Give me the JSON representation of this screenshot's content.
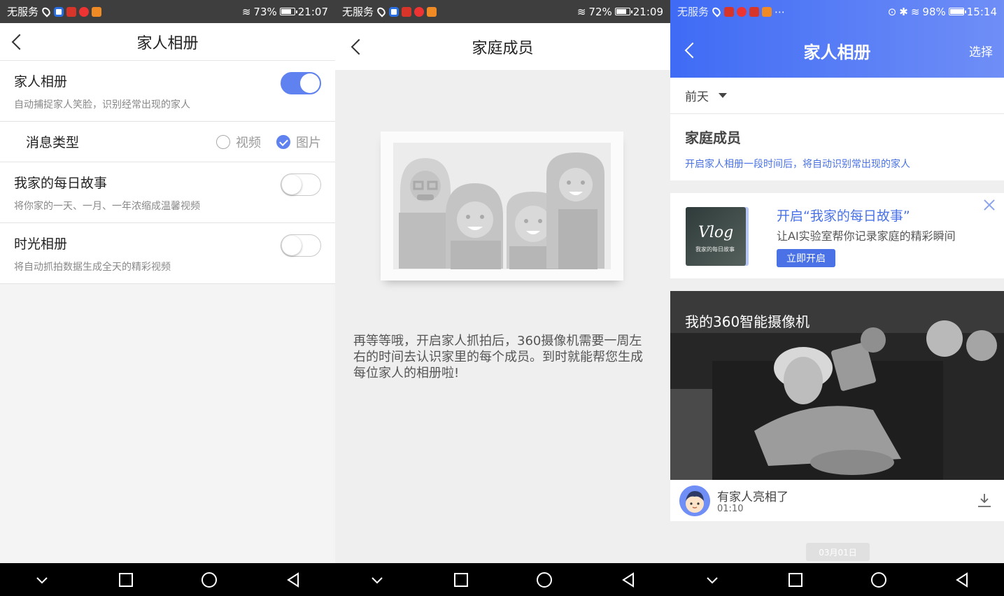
{
  "panel1": {
    "status": {
      "carrier": "无服务",
      "battery": "73%",
      "battery_fill": 0.73,
      "time": "21:07"
    },
    "title": "家人相册",
    "rows": [
      {
        "title": "家人相册",
        "desc": "自动捕捉家人笑脸，识别经常出现的家人",
        "toggle_on": true
      },
      {
        "title": "我家的每日故事",
        "desc": "将你家的一天、一月、一年浓缩成温馨视频",
        "toggle_on": false
      },
      {
        "title": "时光相册",
        "desc": "将自动抓拍数据生成全天的精彩视频",
        "toggle_on": false
      }
    ],
    "msg_type": {
      "label": "消息类型",
      "options": [
        {
          "label": "视频",
          "checked": false
        },
        {
          "label": "图片",
          "checked": true
        }
      ]
    }
  },
  "panel2": {
    "status": {
      "carrier": "无服务",
      "battery": "72%",
      "battery_fill": 0.72,
      "time": "21:09"
    },
    "title": "家庭成员",
    "message": "再等等哦，开启家人抓拍后，360摄像机需要一周左右的时间去认识家里的每个成员。到时就能帮您生成每位家人的相册啦!"
  },
  "panel3": {
    "status": {
      "carrier": "无服务",
      "battery": "98%",
      "battery_fill": 0.98,
      "time": "15:14"
    },
    "title": "家人相册",
    "select": "选择",
    "date_filter": "前天",
    "family": {
      "title": "家庭成员",
      "desc": "开启家人相册一段时间后，将自动识别常出现的家人"
    },
    "promo": {
      "title": "开启“我家的每日故事”",
      "desc": "让AI实验室帮你记录家庭的精彩瞬间",
      "button": "立即开启",
      "image_text": "Vlog",
      "image_sub": "我家的每日故事"
    },
    "camera": {
      "title": "我的360智能摄像机"
    },
    "event": {
      "title": "有家人亮相了",
      "time": "01:10"
    },
    "date_pill": "03月01日"
  },
  "colors": {
    "accent": "#5f82f0",
    "link": "#4a72e6",
    "header_gradient_start": "#3f6bf5",
    "header_gradient_end": "#6f8ef6"
  },
  "icons": {
    "back": "chevron-left-icon",
    "nav": [
      "chevron-down-icon",
      "square-icon",
      "circle-icon",
      "triangle-back-icon"
    ],
    "download": "download-icon",
    "close": "close-icon"
  }
}
